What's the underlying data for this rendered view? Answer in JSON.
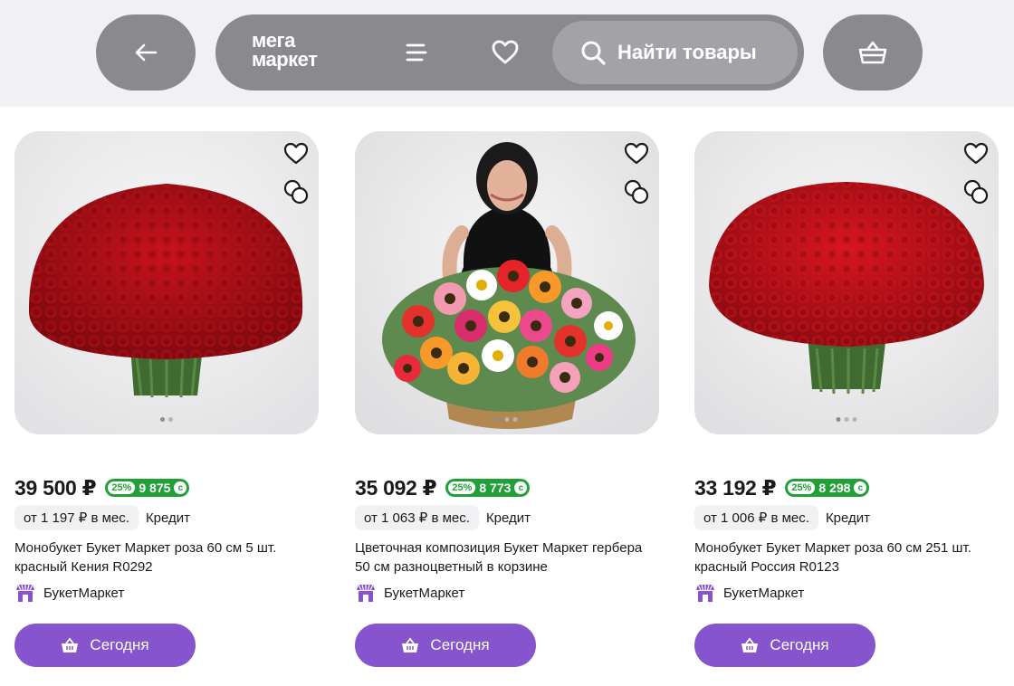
{
  "header": {
    "logo_line1": "мега",
    "logo_line2": "маркет",
    "search_placeholder": "Найти товары",
    "icons": {
      "back": "arrow-left-icon",
      "menu": "menu-icon",
      "favorites": "heart-icon",
      "search": "search-icon",
      "cart": "cart-icon"
    }
  },
  "colors": {
    "header_bg": "#f1f1f3",
    "pill": "#8a8a8e",
    "bonus_green": "#21a038",
    "accent_purple": "#8654cc"
  },
  "products": [
    {
      "price": "39 500 ₽",
      "bonus_percent": "25%",
      "bonus_amount": "9 875",
      "monthly": "от 1 197 ₽ в мес.",
      "credit": "Кредит",
      "title": "Монобукет Букет Маркет роза 60 см 5 шт. красный Кения R0292",
      "seller": "БукетМаркет",
      "button": "Сегодня",
      "image": "red-roses-bouquet"
    },
    {
      "price": "35 092 ₽",
      "bonus_percent": "25%",
      "bonus_amount": "8 773",
      "monthly": "от 1 063 ₽ в мес.",
      "credit": "Кредит",
      "title": "Цветочная композиция Букет Маркет гербера 50 см разноцветный в корзине",
      "seller": "БукетМаркет",
      "button": "Сегодня",
      "image": "gerbera-basket-with-woman"
    },
    {
      "price": "33 192 ₽",
      "bonus_percent": "25%",
      "bonus_amount": "8 298",
      "monthly": "от 1 006 ₽ в мес.",
      "credit": "Кредит",
      "title": "Монобукет Букет Маркет роза 60 см 251 шт. красный Россия R0123",
      "seller": "БукетМаркет",
      "button": "Сегодня",
      "image": "red-roses-bouquet"
    }
  ]
}
